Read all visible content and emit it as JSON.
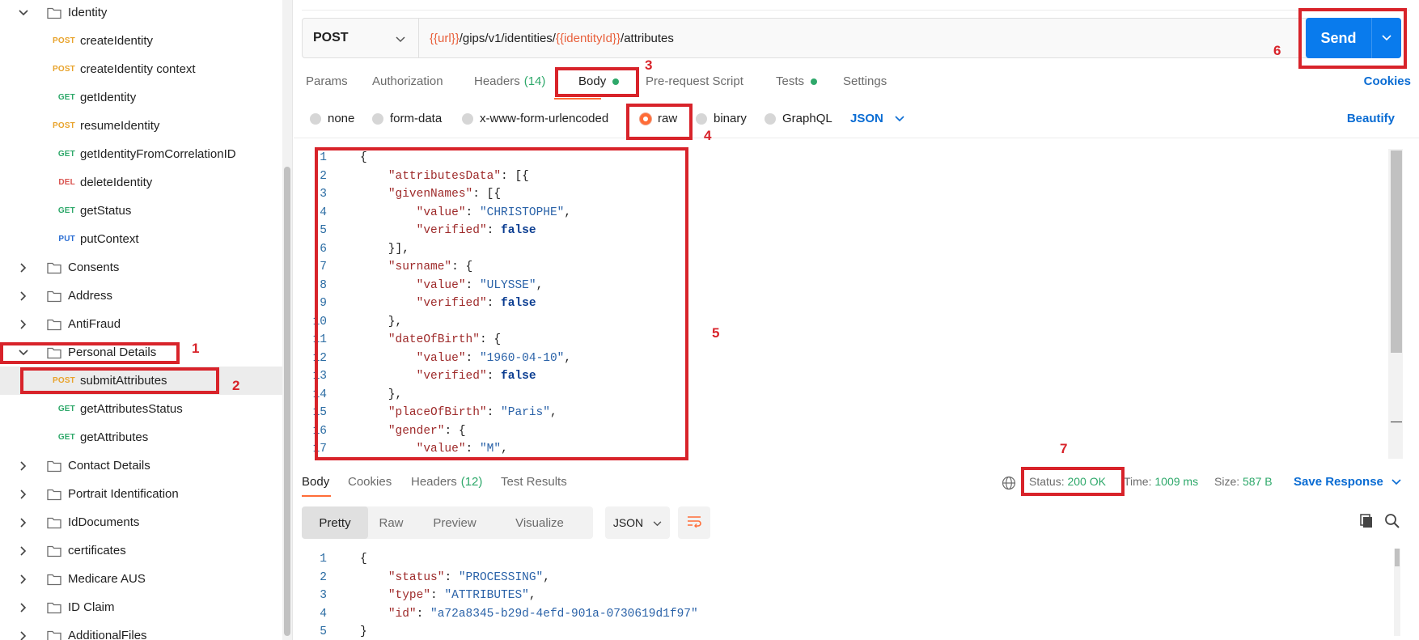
{
  "sidebar": {
    "identity_folder": "Identity",
    "identity_requests": [
      {
        "method": "POST",
        "label": "createIdentity"
      },
      {
        "method": "POST",
        "label": "createIdentity context"
      },
      {
        "method": "GET",
        "label": "getIdentity"
      },
      {
        "method": "POST",
        "label": "resumeIdentity"
      },
      {
        "method": "GET",
        "label": "getIdentityFromCorrelationID"
      },
      {
        "method": "DEL",
        "label": "deleteIdentity"
      },
      {
        "method": "GET",
        "label": "getStatus"
      },
      {
        "method": "PUT",
        "label": "putContext"
      }
    ],
    "folders_before": [
      "Consents",
      "Address",
      "AntiFraud"
    ],
    "personal_details_folder": "Personal Details",
    "personal_details_requests": [
      {
        "method": "POST",
        "label": "submitAttributes"
      },
      {
        "method": "GET",
        "label": "getAttributesStatus"
      },
      {
        "method": "GET",
        "label": "getAttributes"
      }
    ],
    "folders_after": [
      "Contact Details",
      "Portrait Identification",
      "IdDocuments",
      "certificates",
      "Medicare AUS",
      "ID Claim",
      "AdditionalFiles"
    ]
  },
  "request": {
    "method": "POST",
    "url_var_1": "{{url}}",
    "url_mid": "/gips/v1/identities/",
    "url_var_2": "{{identityId}}",
    "url_end": "/attributes",
    "send_label": "Send"
  },
  "request_tabs": {
    "params": "Params",
    "authorization": "Authorization",
    "headers": "Headers",
    "headers_count": "(14)",
    "body": "Body",
    "pre_request": "Pre-request Script",
    "tests": "Tests",
    "settings": "Settings",
    "cookies": "Cookies"
  },
  "body_types": {
    "none": "none",
    "form_data": "form-data",
    "urlencoded": "x-www-form-urlencoded",
    "raw": "raw",
    "binary": "binary",
    "graphql": "GraphQL",
    "format": "JSON",
    "beautify": "Beautify"
  },
  "request_body_lines": [
    {
      "n": "1",
      "t": "{"
    },
    {
      "n": "2",
      "t": "    \"attributesData\": [{"
    },
    {
      "n": "3",
      "t": "    \"givenNames\": [{"
    },
    {
      "n": "4",
      "t": "        \"value\": \"CHRISTOPHE\","
    },
    {
      "n": "5",
      "t": "        \"verified\": false"
    },
    {
      "n": "6",
      "t": "    }],"
    },
    {
      "n": "7",
      "t": "    \"surname\": {"
    },
    {
      "n": "8",
      "t": "        \"value\": \"ULYSSE\","
    },
    {
      "n": "9",
      "t": "        \"verified\": false"
    },
    {
      "n": "10",
      "t": "    },"
    },
    {
      "n": "11",
      "t": "    \"dateOfBirth\": {"
    },
    {
      "n": "12",
      "t": "        \"value\": \"1960-04-10\","
    },
    {
      "n": "13",
      "t": "        \"verified\": false"
    },
    {
      "n": "14",
      "t": "    },"
    },
    {
      "n": "15",
      "t": "    \"placeOfBirth\": \"Paris\","
    },
    {
      "n": "16",
      "t": "    \"gender\": {"
    },
    {
      "n": "17",
      "t": "        \"value\": \"M\","
    }
  ],
  "response_tabs": {
    "body": "Body",
    "cookies": "Cookies",
    "headers": "Headers",
    "headers_count": "(12)",
    "test_results": "Test Results"
  },
  "response_status": {
    "status_label": "Status:",
    "status_value": "200 OK",
    "time_label": "Time:",
    "time_value": "1009 ms",
    "size_label": "Size:",
    "size_value": "587 B",
    "save_response": "Save Response"
  },
  "response_view": {
    "pretty": "Pretty",
    "raw": "Raw",
    "preview": "Preview",
    "visualize": "Visualize",
    "format": "JSON"
  },
  "response_body_lines": [
    {
      "n": "1",
      "t": "{"
    },
    {
      "n": "2",
      "t": "    \"status\": \"PROCESSING\","
    },
    {
      "n": "3",
      "t": "    \"type\": \"ATTRIBUTES\","
    },
    {
      "n": "4",
      "t": "    \"id\": \"a72a8345-b29d-4efd-901a-0730619d1f97\""
    },
    {
      "n": "5",
      "t": "}"
    }
  ],
  "annotations": [
    "1",
    "2",
    "3",
    "4",
    "5",
    "6",
    "7"
  ],
  "colors": {
    "annotation_red": "#d8232a",
    "send_blue": "#097bed",
    "accent_orange": "#ff6c37",
    "success_green": "#2ea86a"
  }
}
